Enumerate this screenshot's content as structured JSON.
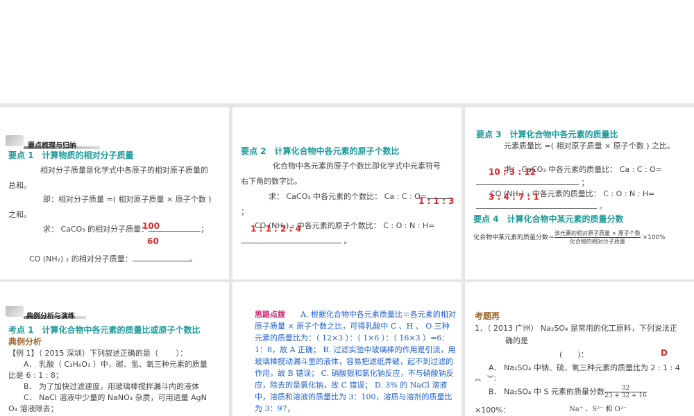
{
  "p1": {
    "section": "要点梳理与归纳",
    "title": "要点 1　计算物质的相对分子质量",
    "l1": "相对分子质量是化学式中各原子的相对原子质量的",
    "l2": "总和。",
    "l3": "即：相对分子质量 =( 相对原子质量 × 原子个数 )",
    "l4": "之和。",
    "l5": "求： CaCO₃ 的相对分子质量：",
    "a1": "100",
    "a2": "60",
    "l6": "CO (NH₂) ₂ 的相对分子质量：",
    "end": "。"
  },
  "p2": {
    "title": "要点 2　计算化合物中各元素的原子个数比",
    "l1": "化合物中各元素的原子个数比即化学式中元素符号",
    "l2": "右下角的数字比。",
    "l3": "求： CaCO₃ 中各元素的个数比： Ca : C : O=",
    "a1": "1 : 1 : 3",
    "l4": "；",
    "l5": "CO (NH₂) ₂ 中各元素的原子个数比： C : O : N : H=",
    "a2": "1 : 1 : 2 : 4",
    "end": "。"
  },
  "p3": {
    "title": "要点 3　计算化合物中各元素的质量比",
    "l1": "元素质量比 =( 相对原子质量 × 原子个数 ) 之比。",
    "l2": "求： CaCO₃ 中各元素的质量比： Ca : C : O=",
    "a1": "10 : 3 : 12",
    "l3": "；",
    "l4": "CO (NH₂) ₂ 中各元素的质量比： C : O : N : H=",
    "a2": "3 : 4 : 7 : 1",
    "end": "。",
    "title2": "要点 4　计算化合物中某元素的质量分数",
    "f_label": "化合物中某元素的质量分数＝",
    "f_num": "该元素的相对原子质量 × 原子个数",
    "f_den": "化合物的相对分子质量",
    "f_mult": "×100%"
  },
  "p4": {
    "section": "典例分析与演练",
    "title": "考点 1　计算化合物中各元素的质量比或原子个数比",
    "sub": "典例分析",
    "q": "【例 1】（ 2015 深圳）下列叙述正确的是（　　 ）：",
    "a": "A． 乳酸（ C₃H₆O₃ ）中，碳、氢、氧三种元素的质量",
    "a2": "比是 6 : 1 : 8；",
    "b": "B． 为了加快过滤速度，用玻璃棒搅拌漏斗内的液体",
    "c": "C． NaCl 溶液中少量的 NaNO₃ 杂质，可用适量 AgN",
    "c2": "O₃ 溶液除去；"
  },
  "p5": {
    "label": "思路点拨",
    "text": "A. 根据化合物中各元素质量比＝各元素的相对原子质量 × 原子个数之比，可得乳酸中 C 、H 、 O 三种元素的质量比为：（ 12×3 ）：（ 1×6 ）：（ 16×3 ）=6：1：8，故 A 正确； B. 过滤实验中玻璃棒的作用是引流，用玻璃棒搅动漏斗里的液体，容易把滤纸弄破，起不到过滤的作用，故 B 错误； C. 硝酸银和氯化钠反应，不与硝酸钠反应，除去的是氯化钠，故 C 错误； D. 3% 的 NaCl 溶液中，溶质和溶液的质量比为 3：100，溶质与溶剂的质量比为 3：97，"
  },
  "p6": {
    "title": "考题再",
    "q": "1．（ 2013 广州） Na₂SO₄ 是常用的化工原料，下列说法正",
    "q2": "确的是",
    "paren": "(　　)：",
    "ans": "D",
    "a": "A． Na₂SO₄ 中钠、硫、氧三种元素的质量比为 2 : 1 : 4",
    "a2": "︽　︾：",
    "b": "B． Na₂SO₄ 中 S 元素的质量分数",
    "b_num": "32",
    "b_den": "23 + 32 + 16",
    "b2": "×100%：",
    "ions": "Na⁺ 、S²⁻ 和 O²⁻"
  }
}
